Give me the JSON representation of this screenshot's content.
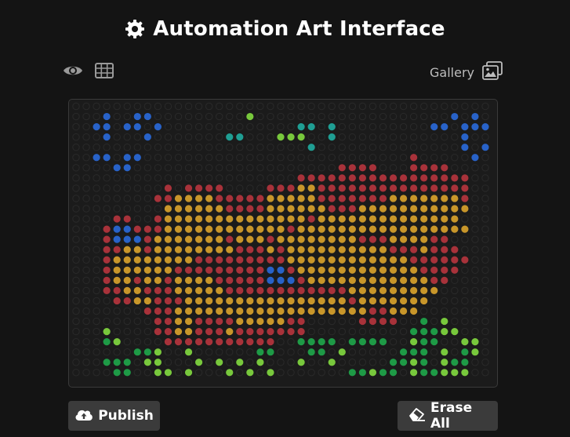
{
  "header": {
    "title": "Automation Art Interface",
    "title_icon": "gear-icon"
  },
  "toolbar": {
    "view_icon": "eye-icon",
    "grid_icon": "grid-icon",
    "gallery_label": "Gallery",
    "gallery_icon": "images-icon"
  },
  "canvas": {
    "columns": 41,
    "rows": 27,
    "background_dot_color": "#2a2a2a",
    "palette": {
      "R": "#a8323a",
      "Y": "#c8962a",
      "B": "#2862c8",
      "T": "#1f9e93",
      "L": "#78c83c",
      "G": "#1e9a46"
    },
    "pixels": [
      ".........................................",
      "...B..BB.........L...................B.B.",
      "..BB.BB.B.............TT.T.........BB.BBB",
      "...B...B.......TT...LLL..T............B..",
      ".......................T..............B.B",
      "..BB.BB..........................R.....B.",
      "....BB....................RRRR...RRRR....",
      "......................RRRRRRRRRRRRRRRRR..",
      ".........R.RRRR....RRRYYRRRRRRRRRRRRRRR..",
      "........RRYYYYRRRRRYYYYYRRRRRRRYYYYYYYR..",
      ".........YYYYYYRRRRYYYYYYRRRYYYYYYYYYYY..",
      "....RR..RYYYYYYYYYYYYYYRYYYYYYYYYYYYYY...",
      "...RBBRRRYYYYYYYYYYYYRYYYYYYYYYYYYYYYYY..",
      "...RBBBRYYYYYYYRYYYRYYYYYYYYRRRYYYYRR....",
      "...RRYYRYYYYYYYYRRRYRYYYYYYYYYYRRRYRRR...",
      "...RYYYYYYYYRRRRRRRRRYYYYYYYYYYYYRRRRRR..",
      "...RYYYYYYRRRRRRRRRBBRYYYYYYYYYYYYRRRR...",
      "...RYYRYYRYYYYRRRRRBBBRYYYYYYYYYYYYRR....",
      "...RRYYRRRYYYYYRRRRRRRRRRRRYYYYYYYYY.....",
      "....RRYYRRRYYYYYYYYYYYYYYYYRYYYYYYY.....",
      ".......RRRYYYYYYYYYYYYYYYYYYYRRYYY.......",
      "........RRYYRRRRYYYYYRR.....RRRR..G.L....",
      "...L....RRYYRRRYRRRRRRR..........GGGLL...",
      "...GL....RRRRRRRRRRR..GGGG.GGGG..LGG..LL.",
      "......GGL..L......GG...GG.L.....GGG.L.GL.",
      "...GGG.LL...L.L.L.L...L..L.....GGLG.LGG..",
      "....GG..LL.L...L.L.L.......GGLGG.LGGLLL.."
    ]
  },
  "actions": {
    "publish_label": "Publish",
    "publish_icon": "cloud-upload-icon",
    "erase_label": "Erase All",
    "erase_icon": "eraser-icon"
  }
}
